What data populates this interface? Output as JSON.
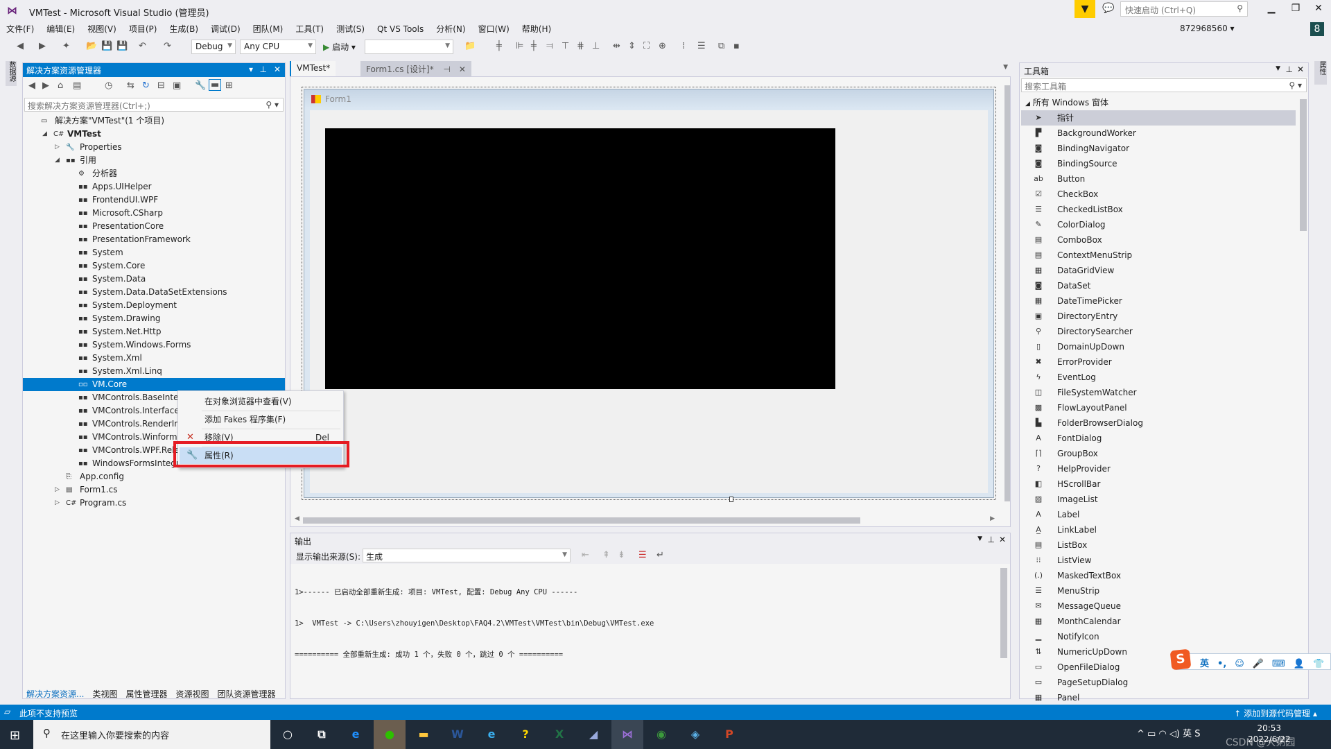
{
  "window": {
    "title": "VMTest - Microsoft Visual Studio (管理员)",
    "quick_launch_placeholder": "快速启动 (Ctrl+Q)",
    "account": "872968560",
    "account_badge": "8",
    "minimize": "▁",
    "maximize": "❐",
    "close": "✕"
  },
  "menu": [
    "文件(F)",
    "编辑(E)",
    "视图(V)",
    "项目(P)",
    "生成(B)",
    "调试(D)",
    "团队(M)",
    "工具(T)",
    "测试(S)",
    "Qt VS Tools",
    "分析(N)",
    "窗口(W)",
    "帮助(H)"
  ],
  "toolbar": {
    "config": "Debug",
    "platform": "Any CPU",
    "start_label": "启动",
    "start_glyph": "▶"
  },
  "left_strip": "数据源",
  "right_strip": "属性",
  "solution_explorer": {
    "title": "解决方案资源管理器",
    "search_placeholder": "搜索解决方案资源管理器(Ctrl+;)",
    "tree": [
      {
        "label": "解决方案\"VMTest\"(1 个项目)",
        "level": 0,
        "icon": "▭",
        "tri": ""
      },
      {
        "label": "VMTest",
        "level": 1,
        "icon": "C#",
        "tri": "◢",
        "bold": true
      },
      {
        "label": "Properties",
        "level": 2,
        "icon": "🔧",
        "tri": "▷"
      },
      {
        "label": "引用",
        "level": 2,
        "icon": "▪▪",
        "tri": "◢"
      },
      {
        "label": "分析器",
        "level": 3,
        "icon": "⚙",
        "tri": ""
      },
      {
        "label": "Apps.UIHelper",
        "level": 3,
        "icon": "▪▪",
        "tri": ""
      },
      {
        "label": "FrontendUI.WPF",
        "level": 3,
        "icon": "▪▪",
        "tri": ""
      },
      {
        "label": "Microsoft.CSharp",
        "level": 3,
        "icon": "▪▪",
        "tri": ""
      },
      {
        "label": "PresentationCore",
        "level": 3,
        "icon": "▪▪",
        "tri": ""
      },
      {
        "label": "PresentationFramework",
        "level": 3,
        "icon": "▪▪",
        "tri": ""
      },
      {
        "label": "System",
        "level": 3,
        "icon": "▪▪",
        "tri": ""
      },
      {
        "label": "System.Core",
        "level": 3,
        "icon": "▪▪",
        "tri": ""
      },
      {
        "label": "System.Data",
        "level": 3,
        "icon": "▪▪",
        "tri": ""
      },
      {
        "label": "System.Data.DataSetExtensions",
        "level": 3,
        "icon": "▪▪",
        "tri": ""
      },
      {
        "label": "System.Deployment",
        "level": 3,
        "icon": "▪▪",
        "tri": ""
      },
      {
        "label": "System.Drawing",
        "level": 3,
        "icon": "▪▪",
        "tri": ""
      },
      {
        "label": "System.Net.Http",
        "level": 3,
        "icon": "▪▪",
        "tri": ""
      },
      {
        "label": "System.Windows.Forms",
        "level": 3,
        "icon": "▪▪",
        "tri": ""
      },
      {
        "label": "System.Xml",
        "level": 3,
        "icon": "▪▪",
        "tri": ""
      },
      {
        "label": "System.Xml.Linq",
        "level": 3,
        "icon": "▪▪",
        "tri": ""
      },
      {
        "label": "VM.Core",
        "level": 3,
        "icon": "▫▫",
        "tri": "",
        "selected": true
      },
      {
        "label": "VMControls.BaseInterface",
        "level": 3,
        "icon": "▪▪",
        "tri": ""
      },
      {
        "label": "VMControls.Interface",
        "level": 3,
        "icon": "▪▪",
        "tri": ""
      },
      {
        "label": "VMControls.RenderInterface",
        "level": 3,
        "icon": "▪▪",
        "tri": ""
      },
      {
        "label": "VMControls.Winform.Release",
        "level": 3,
        "icon": "▪▪",
        "tri": ""
      },
      {
        "label": "VMControls.WPF.Release",
        "level": 3,
        "icon": "▪▪",
        "tri": ""
      },
      {
        "label": "WindowsFormsIntegration",
        "level": 3,
        "icon": "▪▪",
        "tri": ""
      },
      {
        "label": "App.config",
        "level": 2,
        "icon": "⎘",
        "tri": ""
      },
      {
        "label": "Form1.cs",
        "level": 2,
        "icon": "▤",
        "tri": "▷"
      },
      {
        "label": "Program.cs",
        "level": 2,
        "icon": "C#",
        "tri": "▷"
      }
    ],
    "bottom_tabs": [
      "解决方案资源...",
      "类视图",
      "属性管理器",
      "资源视图",
      "团队资源管理器"
    ]
  },
  "context_menu": {
    "items": [
      {
        "label": "在对象浏览器中查看(V)",
        "key": "",
        "icon": ""
      },
      {
        "label": "添加 Fakes 程序集(F)",
        "key": "",
        "icon": ""
      },
      {
        "label": "移除(V)",
        "key": "Del",
        "icon": "✕"
      },
      {
        "label": "属性(R)",
        "key": "",
        "icon": "🔧",
        "highlighted": true
      }
    ]
  },
  "editor": {
    "tabs": [
      {
        "label": "VMTest*"
      },
      {
        "label": "Form1.cs [设计]*"
      }
    ],
    "form_title": "Form1"
  },
  "output": {
    "title": "输出",
    "source_label": "显示输出来源(S):",
    "source_value": "生成",
    "lines": [
      "1>------ 已启动全部重新生成: 项目: VMTest, 配置: Debug Any CPU ------",
      "1>  VMTest -> C:\\Users\\zhouyigen\\Desktop\\FAQ4.2\\VMTest\\VMTest\\bin\\Debug\\VMTest.exe",
      "========== 全部重新生成: 成功 1 个，失败 0 个，跳过 0 个 =========="
    ]
  },
  "toolbox": {
    "title": "工具箱",
    "search_placeholder": "搜索工具箱",
    "group": "所有 Windows 窗体",
    "items": [
      {
        "label": "指针",
        "icon": "➤",
        "selected": true
      },
      {
        "label": "BackgroundWorker",
        "icon": "▛"
      },
      {
        "label": "BindingNavigator",
        "icon": "◙"
      },
      {
        "label": "BindingSource",
        "icon": "◙"
      },
      {
        "label": "Button",
        "icon": "ab"
      },
      {
        "label": "CheckBox",
        "icon": "☑"
      },
      {
        "label": "CheckedListBox",
        "icon": "☰"
      },
      {
        "label": "ColorDialog",
        "icon": "✎"
      },
      {
        "label": "ComboBox",
        "icon": "▤"
      },
      {
        "label": "ContextMenuStrip",
        "icon": "▤"
      },
      {
        "label": "DataGridView",
        "icon": "▦"
      },
      {
        "label": "DataSet",
        "icon": "◙"
      },
      {
        "label": "DateTimePicker",
        "icon": "▦"
      },
      {
        "label": "DirectoryEntry",
        "icon": "▣"
      },
      {
        "label": "DirectorySearcher",
        "icon": "⚲"
      },
      {
        "label": "DomainUpDown",
        "icon": "▯"
      },
      {
        "label": "ErrorProvider",
        "icon": "✖"
      },
      {
        "label": "EventLog",
        "icon": "ϟ"
      },
      {
        "label": "FileSystemWatcher",
        "icon": "◫"
      },
      {
        "label": "FlowLayoutPanel",
        "icon": "▩"
      },
      {
        "label": "FolderBrowserDialog",
        "icon": "▙"
      },
      {
        "label": "FontDialog",
        "icon": "A"
      },
      {
        "label": "GroupBox",
        "icon": "⌈⌉"
      },
      {
        "label": "HelpProvider",
        "icon": "?"
      },
      {
        "label": "HScrollBar",
        "icon": "◧"
      },
      {
        "label": "ImageList",
        "icon": "▨"
      },
      {
        "label": "Label",
        "icon": "A"
      },
      {
        "label": "LinkLabel",
        "icon": "A̲"
      },
      {
        "label": "ListBox",
        "icon": "▤"
      },
      {
        "label": "ListView",
        "icon": "⁝⁝"
      },
      {
        "label": "MaskedTextBox",
        "icon": "(.)"
      },
      {
        "label": "MenuStrip",
        "icon": "☰"
      },
      {
        "label": "MessageQueue",
        "icon": "✉"
      },
      {
        "label": "MonthCalendar",
        "icon": "▦"
      },
      {
        "label": "NotifyIcon",
        "icon": "▁"
      },
      {
        "label": "NumericUpDown",
        "icon": "⇅"
      },
      {
        "label": "OpenFileDialog",
        "icon": "▭"
      },
      {
        "label": "PageSetupDialog",
        "icon": "▭"
      },
      {
        "label": "Panel",
        "icon": "▦"
      }
    ]
  },
  "statusbar": {
    "text": "此项不支持预览",
    "scm": "↑ 添加到源代码管理 ▴"
  },
  "ime": {
    "logo": "S",
    "items": [
      "英",
      "•,",
      "☺",
      "🎤",
      "⌨",
      "👤",
      "👕",
      "▦"
    ]
  },
  "taskbar": {
    "search_placeholder": "在这里输入你要搜索的内容",
    "apps": [
      {
        "name": "cortana",
        "glyph": "○",
        "color": "#ffffff"
      },
      {
        "name": "task-view",
        "glyph": "⧉",
        "color": "#ffffff"
      },
      {
        "name": "edge",
        "glyph": "e",
        "color": "#1e90ff"
      },
      {
        "name": "wechat",
        "glyph": "●",
        "color": "#2dc100"
      },
      {
        "name": "file-explorer",
        "glyph": "▬",
        "color": "#ffc83d"
      },
      {
        "name": "word",
        "glyph": "W",
        "color": "#2b579a"
      },
      {
        "name": "ie",
        "glyph": "e",
        "color": "#3ab0f0"
      },
      {
        "name": "help",
        "glyph": "?",
        "color": "#ffd700"
      },
      {
        "name": "excel",
        "glyph": "X",
        "color": "#217346"
      },
      {
        "name": "notes",
        "glyph": "◢",
        "color": "#9ad"
      },
      {
        "name": "visual-studio",
        "glyph": "⋈",
        "color": "#9b6fd6"
      },
      {
        "name": "app-green",
        "glyph": "◉",
        "color": "#3c9a3c"
      },
      {
        "name": "app-blue",
        "glyph": "◈",
        "color": "#5bb0e6"
      },
      {
        "name": "powerpoint",
        "glyph": "P",
        "color": "#d24726"
      }
    ],
    "tray": "^  ▭  ◠  ◁)  英  S",
    "time": "20:53",
    "date": "2022/6/22",
    "watermark": "CSDN @大粥园"
  }
}
